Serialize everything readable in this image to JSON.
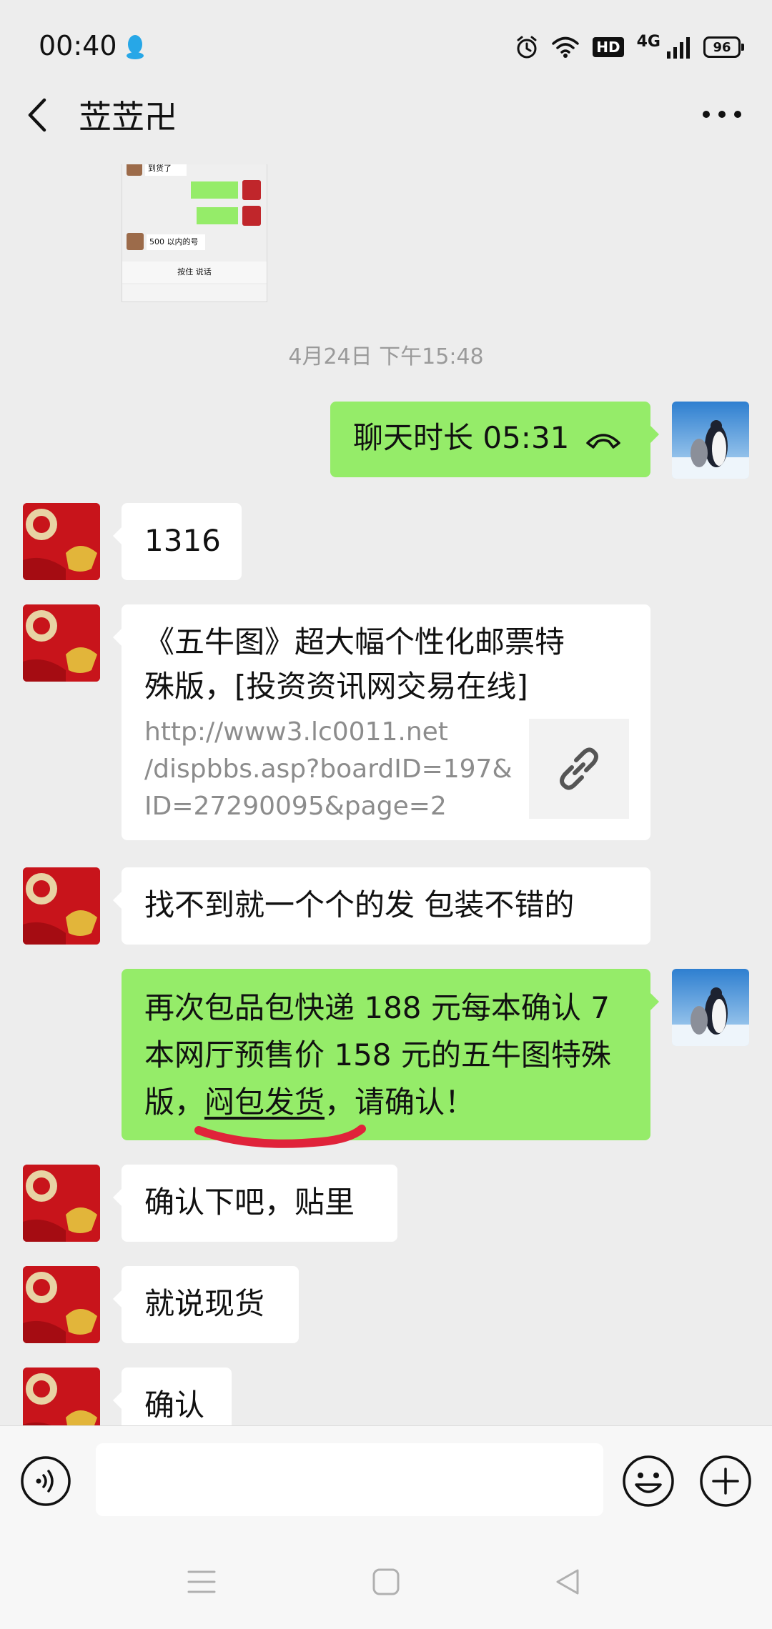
{
  "status_bar": {
    "time": "00:40",
    "hd_label": "HD",
    "network_label": "4G",
    "battery_level": "96"
  },
  "header": {
    "title": "苙苙卍"
  },
  "thumbnail": {
    "line1": "到货了",
    "line2": "500 以内的号",
    "bar_label": "按住 说话"
  },
  "timestamp": "4月24日 下午15:48",
  "messages": [
    {
      "side": "right",
      "type": "call",
      "text": "聊天时长 05:31"
    },
    {
      "side": "left",
      "type": "text",
      "text": "1316"
    },
    {
      "side": "left",
      "type": "link",
      "title_line1": "《五牛图》超大幅个性化邮票特",
      "title_line2": "殊版，[投资资讯网交易在线]",
      "url_line1": "http://www3.lc0011.net",
      "url_line2": "/dispbbs.asp?boardID=197&",
      "url_line3": "ID=27290095&page=2"
    },
    {
      "side": "left",
      "type": "text",
      "text": "找不到就一个个的发 包装不错的"
    },
    {
      "side": "right",
      "type": "text",
      "line1": "再次包品包快递 188 元每本确认 7",
      "line2": "本网厅预售价 158 元的五牛图特殊",
      "line3_pre": "版，",
      "line3_highlight": "闷包发货",
      "line3_post": "，请确认！"
    },
    {
      "side": "left",
      "type": "text",
      "text": "确认下吧，贴里"
    },
    {
      "side": "left",
      "type": "text",
      "text": "就说现货"
    },
    {
      "side": "left",
      "type": "text",
      "text": "确认"
    }
  ],
  "colors": {
    "background": "#EDEDED",
    "bubble_green": "#95EC69",
    "bubble_white": "#FFFFFF",
    "annotation_red": "#E0233A"
  },
  "icons": [
    "qq-icon",
    "alarm-icon",
    "wifi-icon",
    "signal-icon",
    "back-icon",
    "more-icon",
    "phone-icon",
    "link-icon",
    "voice-icon",
    "emoji-icon",
    "add-icon",
    "menu-icon",
    "home-icon",
    "back-nav-icon"
  ]
}
